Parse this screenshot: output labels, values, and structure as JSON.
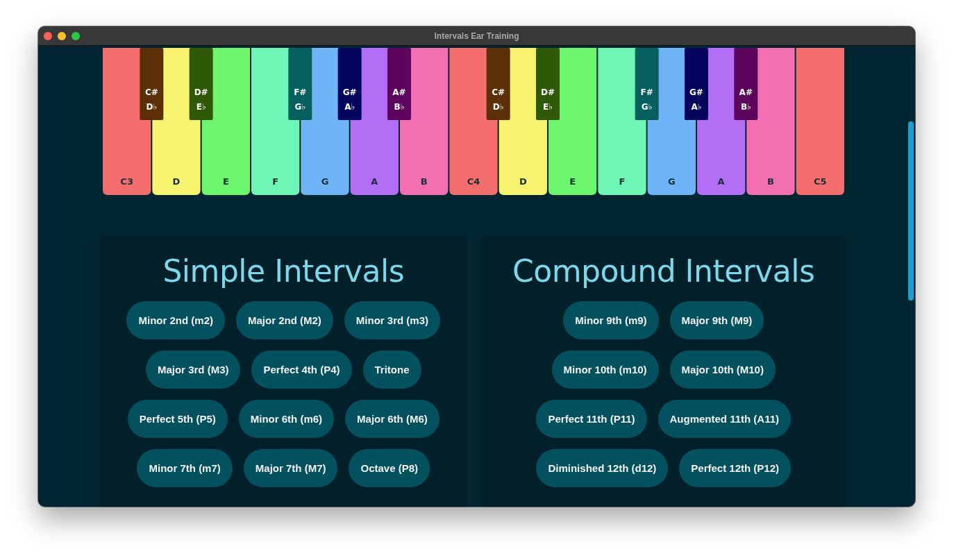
{
  "window": {
    "title": "Intervals Ear Training"
  },
  "piano": {
    "keys": [
      {
        "label": "C3",
        "color": "#f46e6e",
        "black_key": {
          "sharp": "C#",
          "flat": "D♭",
          "color": "#5c2f07"
        }
      },
      {
        "label": "D",
        "color": "#f7f36e",
        "black_key": {
          "sharp": "D#",
          "flat": "E♭",
          "color": "#2f5906"
        }
      },
      {
        "label": "E",
        "color": "#6df56e"
      },
      {
        "label": "F",
        "color": "#6ef6b6",
        "black_key": {
          "sharp": "F#",
          "flat": "G♭",
          "color": "#045f5e"
        }
      },
      {
        "label": "G",
        "color": "#6fb4f6",
        "black_key": {
          "sharp": "G#",
          "flat": "A♭",
          "color": "#05055e"
        }
      },
      {
        "label": "A",
        "color": "#b26ff6",
        "black_key": {
          "sharp": "A#",
          "flat": "B♭",
          "color": "#5d055c"
        }
      },
      {
        "label": "B",
        "color": "#f46fb2"
      },
      {
        "label": "C4",
        "color": "#f46e6e",
        "black_key": {
          "sharp": "C#",
          "flat": "D♭",
          "color": "#5c2f07"
        }
      },
      {
        "label": "D",
        "color": "#f7f36e",
        "black_key": {
          "sharp": "D#",
          "flat": "E♭",
          "color": "#2f5906"
        }
      },
      {
        "label": "E",
        "color": "#6df56e"
      },
      {
        "label": "F",
        "color": "#6ef6b6",
        "black_key": {
          "sharp": "F#",
          "flat": "G♭",
          "color": "#045f5e"
        }
      },
      {
        "label": "G",
        "color": "#6fb4f6",
        "black_key": {
          "sharp": "G#",
          "flat": "A♭",
          "color": "#05055e"
        }
      },
      {
        "label": "A",
        "color": "#b26ff6",
        "black_key": {
          "sharp": "A#",
          "flat": "B♭",
          "color": "#5d055c"
        }
      },
      {
        "label": "B",
        "color": "#f46fb2"
      },
      {
        "label": "C5",
        "color": "#f46e6e"
      }
    ]
  },
  "panels": [
    {
      "title": "Simple Intervals",
      "rows": [
        [
          "Minor 2nd (m2)",
          "Major 2nd (M2)",
          "Minor 3rd (m3)"
        ],
        [
          "Major 3rd (M3)",
          "Perfect 4th (P4)",
          "Tritone"
        ],
        [
          "Perfect 5th (P5)",
          "Minor 6th (m6)",
          "Major 6th (M6)"
        ],
        [
          "Minor 7th (m7)",
          "Major 7th (M7)",
          "Octave (P8)"
        ]
      ]
    },
    {
      "title": "Compound Intervals",
      "rows": [
        [
          "Minor 9th (m9)",
          "Major 9th (M9)"
        ],
        [
          "Minor 10th (m10)",
          "Major 10th (M10)"
        ],
        [
          "Perfect 11th (P11)",
          "Augmented 11th (A11)"
        ],
        [
          "Diminished 12th (d12)",
          "Perfect 12th (P12)"
        ]
      ]
    }
  ]
}
